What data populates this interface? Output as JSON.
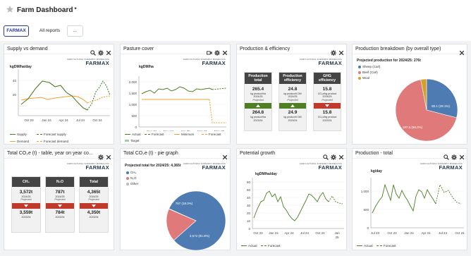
{
  "header": {
    "title": "Farm Dashboard",
    "dirty": "*"
  },
  "tabs": [
    {
      "label": "FARMAX"
    },
    {
      "label": "All reports"
    },
    {
      "label": "..."
    }
  ],
  "logo": {
    "sub": "AGRICULTURAL SCENARIO MODELLING",
    "main": "FARMAX"
  },
  "colors": {
    "accent": "#2a3aa0",
    "green": "#4e7f24",
    "orange": "#f0a030",
    "red": "#c0392b",
    "blue": "#4f7bb3",
    "pink": "#e07a7a",
    "gold": "#d4a028"
  },
  "widgets": {
    "supply": {
      "title": "Supply vs demand",
      "unit": "kgDM/ha/day",
      "legend": [
        "Supply",
        "Forecast supply",
        "Demand",
        "Forecast demand"
      ],
      "chart_data": {
        "type": "line",
        "ylabel": "kgDM/ha/day",
        "ylim": [
          0,
          60
        ],
        "yticks": [
          0,
          20,
          40
        ],
        "xticks": [
          "Oct 23",
          "Jan 24",
          "Apr 24",
          "Jul 24",
          "Oct 24"
        ],
        "series": [
          {
            "name": "Supply",
            "values": [
              16,
              24,
              38,
              49,
              47,
              41,
              43,
              33,
              28,
              19,
              11,
              8
            ]
          },
          {
            "name": "Forecast supply",
            "values": [
              null,
              null,
              null,
              null,
              null,
              null,
              null,
              null,
              null,
              null,
              null,
              8,
              17,
              34,
              40,
              49,
              42,
              29
            ]
          },
          {
            "name": "Demand",
            "values": [
              22,
              24,
              25,
              26,
              23,
              25,
              26,
              27,
              28,
              27,
              23,
              18
            ]
          },
          {
            "name": "Forecast demand",
            "values": [
              null,
              null,
              null,
              null,
              null,
              null,
              null,
              null,
              null,
              null,
              null,
              18,
              21,
              23,
              26,
              27,
              28,
              29
            ]
          }
        ]
      }
    },
    "pasture": {
      "title": "Pasture cover",
      "unit": "kgDM/ha",
      "legend": [
        "Actual",
        "Forecast",
        "Minimum",
        "Forecast",
        "Target"
      ],
      "chart_data": {
        "type": "line",
        "ylabel": "kgDM/ha",
        "ylim": [
          0,
          2200
        ],
        "yticks": [
          "0",
          "500",
          "1,000",
          "1,500",
          "2,000"
        ],
        "xticks": [
          "Sep 24",
          "Nov 24",
          "Jan 25",
          "Mar 25",
          "May 25"
        ],
        "series": [
          {
            "name": "Actual",
            "values": [
              1460,
              1580,
              1620,
              1540,
              1720,
              1680,
              1740,
              1620,
              1700,
              1800,
              1760,
              1650,
              1600,
              1700,
              1680,
              1720,
              1760,
              1700
            ]
          },
          {
            "name": "Forecast",
            "values": [
              null,
              null,
              null,
              null,
              null,
              null,
              null,
              null,
              null,
              null,
              null,
              null,
              null,
              null,
              null,
              null,
              null,
              1700,
              1720,
              1750
            ]
          },
          {
            "name": "Minimum",
            "values": [
              1200,
              1200,
              1200,
              1200,
              1200,
              1200,
              1200,
              1200,
              1200,
              1200,
              1200,
              1200,
              1200,
              1200,
              1200,
              1200,
              1200
            ]
          },
          {
            "name": "Forecast",
            "values": [
              null,
              null,
              null,
              null,
              null,
              null,
              null,
              null,
              null,
              null,
              null,
              null,
              null,
              null,
              null,
              null,
              1200,
              200,
              200,
              200
            ]
          }
        ]
      }
    },
    "efficiency": {
      "title": "Production & efficiency",
      "cards": [
        {
          "head": [
            "Production",
            "total"
          ],
          "value": "265.4",
          "unit": "kg product/ha",
          "year": "2024/25",
          "tag": "Projected",
          "dir": "up",
          "prev": "264.8",
          "punit": "kg product/ha",
          "pyear": "2023/24"
        },
        {
          "head": [
            "Production",
            "efficiency"
          ],
          "value": "24.8",
          "unit": "kg product/t DM",
          "year": "2024/25",
          "tag": "Projected",
          "dir": "up",
          "prev": "24.9",
          "punit": "kg product/t DM",
          "pyear": "2023/24"
        },
        {
          "head": [
            "GHG",
            "efficiency"
          ],
          "value": "15.8",
          "unit": "CO₂e/kg product",
          "year": "2024/25",
          "tag": "Projected",
          "dir": "down",
          "prev": "15.8",
          "punit": "CO₂e/kg product",
          "pyear": "2023/24"
        }
      ]
    },
    "breakdown": {
      "title": "Production breakdown (by overall type)",
      "subtitle": "Projected production for 2024/25: 276t",
      "chart_data": {
        "type": "pie",
        "slices": [
          {
            "name": "Sheep (Carl)",
            "value": 80.1,
            "pct": 29.1,
            "label": "80.1 (29.1%)",
            "color": "#4f7bb3"
          },
          {
            "name": "Beef (Carl)",
            "value": 187.6,
            "pct": 68.0,
            "label": "187.6 (68.0%)",
            "color": "#e07a7a"
          },
          {
            "name": "Wool",
            "value": 8.3,
            "pct": 2.9,
            "label": "",
            "color": "#d4a028"
          }
        ]
      }
    },
    "co2table": {
      "title": "Total CO₂e (t) - table, year on year co...",
      "cards": [
        {
          "head": "CH₄",
          "value": "3,572t",
          "year": "2024/25",
          "tag": "Projected",
          "prev": "3,559t",
          "pyear": "2023/24"
        },
        {
          "head": "N₂O",
          "value": "787t",
          "year": "2024/25",
          "tag": "Projected",
          "prev": "784t",
          "pyear": "2023/24"
        },
        {
          "head": "Total",
          "value": "4,365t",
          "year": "2024/25",
          "tag": "Projected",
          "prev": "4,350t",
          "pyear": "2023/24"
        }
      ]
    },
    "co2pie": {
      "title": "Total CO₂e (t) - pie graph",
      "subtitle": "Projected total for 2024/25: 4,365t",
      "chart_data": {
        "type": "pie",
        "slices": [
          {
            "name": "CH₄",
            "value": 3572,
            "pct": 81.8,
            "label": "3,572 (81.8%)",
            "color": "#4f7bb3"
          },
          {
            "name": "N₂O",
            "value": 787,
            "pct": 18.0,
            "label": "787 (18.0%)",
            "color": "#e07a7a"
          },
          {
            "name": "Other",
            "value": 6,
            "pct": 0.2,
            "label": "",
            "color": "#bbbbbb"
          }
        ]
      }
    },
    "growth": {
      "title": "Potential growth",
      "unit": "kgDM/ha/day",
      "legend": [
        "Actual",
        "Forecast"
      ],
      "chart_data": {
        "type": "line",
        "ylabel": "kgDM/ha/day",
        "ylim": [
          0,
          65
        ],
        "yticks": [
          0,
          10,
          20,
          30,
          40,
          50,
          60
        ],
        "xticks": [
          "Oct 23",
          "Jan 24",
          "Apr 24",
          "Jul 24",
          "Oct 24",
          "Jan 25"
        ],
        "series": [
          {
            "name": "Actual",
            "values": [
              14,
              26,
              34,
              38,
              46,
              48,
              41,
              44,
              36,
              40,
              30,
              24,
              18,
              12,
              9,
              14,
              22,
              30,
              38,
              46,
              44,
              40,
              36
            ]
          },
          {
            "name": "Forecast",
            "values": [
              null,
              null,
              null,
              null,
              null,
              null,
              null,
              null,
              null,
              null,
              null,
              null,
              null,
              null,
              null,
              null,
              null,
              null,
              null,
              null,
              null,
              null,
              36,
              41,
              34,
              32
            ]
          }
        ]
      }
    },
    "prodtotal": {
      "title": "Production - total",
      "unit": "kg/day",
      "legend": [
        "Actual",
        "Forecast"
      ],
      "chart_data": {
        "type": "line",
        "ylabel": "kg/day",
        "ylim": [
          0,
          1300
        ],
        "yticks": [
          0,
          500,
          1000
        ],
        "xticks": [
          "Jul 23",
          "Oct 23",
          "Jan 24",
          "Apr 24",
          "Jul 24",
          "Oct 24"
        ],
        "series": [
          {
            "name": "Actual",
            "values": [
              400,
              620,
              700,
              1150,
              1000,
              850,
              1180,
              900,
              760,
              1020,
              880,
              700,
              600,
              500,
              820,
              1100,
              960,
              880
            ]
          },
          {
            "name": "Forecast",
            "values": [
              null,
              null,
              null,
              null,
              null,
              null,
              null,
              null,
              null,
              null,
              null,
              null,
              null,
              null,
              null,
              null,
              null,
              880,
              1180,
              1000,
              1020,
              820,
              700
            ]
          }
        ]
      }
    }
  }
}
